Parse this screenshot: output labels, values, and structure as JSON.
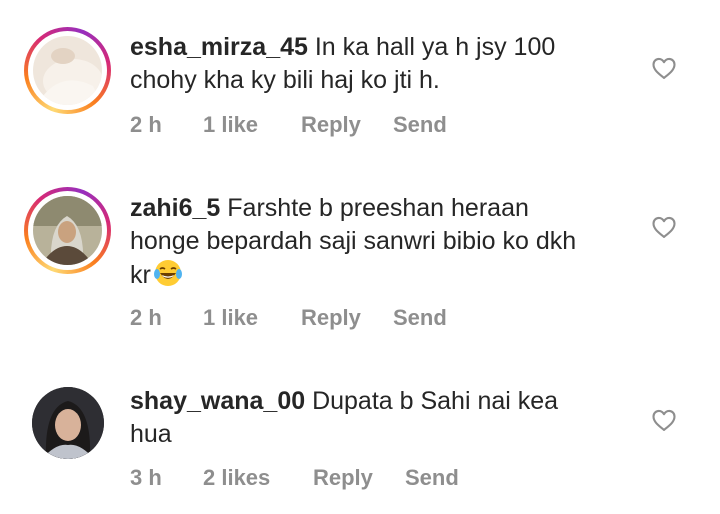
{
  "comments": [
    {
      "username": "esha_mirza_45",
      "text": " In ka hall ya h jsy 100 chohy kha ky bili haj ko jti h.",
      "time": "2 h",
      "likes": "1 like",
      "reply_label": "Reply",
      "send_label": "Send",
      "avatar": "profile-photo",
      "story_ring": true
    },
    {
      "username": "zahi6_5",
      "text": " Farshte b preeshan heraan honge bepardah  saji sanwri bibio ko dkh kr",
      "emoji": "laughing-tears-emoji",
      "time": "2 h",
      "likes": "1 like",
      "reply_label": "Reply",
      "send_label": "Send",
      "avatar": "profile-photo",
      "story_ring": true
    },
    {
      "username": "shay_wana_00",
      "text": " Dupata b Sahi nai kea hua",
      "time": "3 h",
      "likes": "2 likes",
      "reply_label": "Reply",
      "send_label": "Send",
      "avatar": "profile-photo",
      "story_ring": false
    }
  ],
  "colors": {
    "text": "#262626",
    "meta": "#8e8e8e",
    "ring_start": "#feda75",
    "ring_end": "#962fbf"
  },
  "icons": {
    "like": "heart-outline-icon"
  }
}
